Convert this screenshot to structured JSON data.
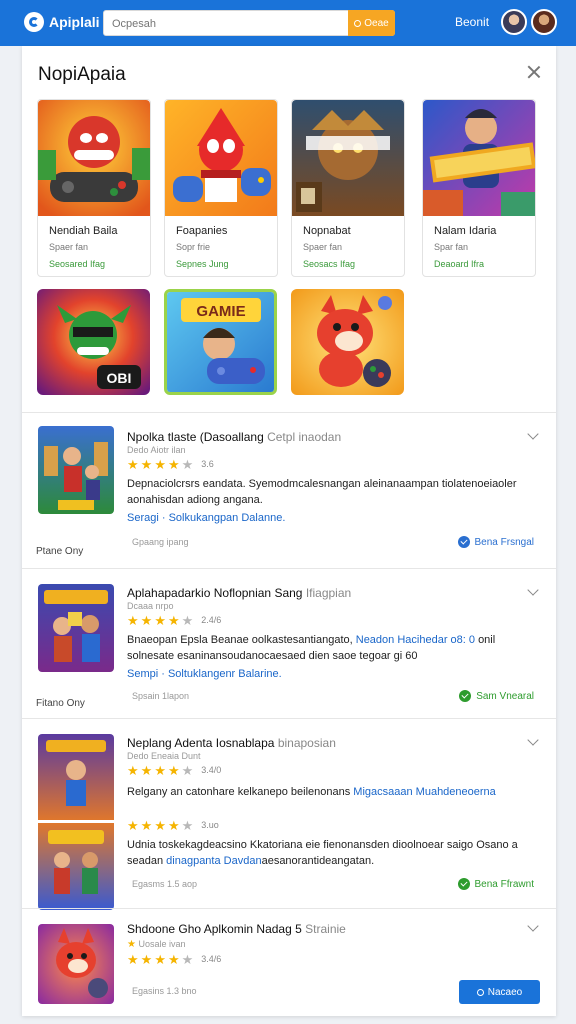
{
  "header": {
    "logo_text": "Apiplali",
    "search_placeholder": "Ocpesah",
    "search_button": "Oeae",
    "user_name": "Beonit"
  },
  "panel": {
    "title": "NopiApaia",
    "cards": [
      {
        "title": "Nendiah Baila",
        "sub": "Spaer fan",
        "status": "Seosared Ifag"
      },
      {
        "title": "Foapanies",
        "sub": "Sopr frie",
        "status": "Sepnes Jung"
      },
      {
        "title": "Nopnabat",
        "sub": "Spaer fan",
        "status": "Seosacs Ifag"
      },
      {
        "title": "Nalam Idaria",
        "sub": "Spar fan",
        "status": "Deaoard Ifra"
      }
    ],
    "tiles": [
      {
        "label": "OBI"
      },
      {
        "label": "GAMIE"
      },
      {
        "label": ""
      }
    ],
    "list": [
      {
        "title": "Npolka tlaste (Dasoallang",
        "title_grey": "Cetpl inaodan",
        "sub": "Dedo Aiotr ilan",
        "rating": "3.6",
        "stars": 4,
        "desc_a": "Depnaciolcrsrs eandata. Syemodmcalesnangan aleinanaampan tiolatenoeiaoler aonahisdan adiong angana.",
        "desc_b": "",
        "link": "Seragi · Solkukangpan Dalanne.",
        "left_note": "Ptane Ony",
        "meta": "Gpaang ipang",
        "status": "Bena Frsngal"
      },
      {
        "title": "Aplahapadarkio Noflopnian Sang",
        "title_grey": "Ifiagpian",
        "sub": "Dcaaa nrpo",
        "rating": "2.4/6",
        "stars": 4,
        "desc_a": "Bnaeopan Epsla Beanae oolkastesantiangato,",
        "desc_b": "Neadon Hacihedar o8: 0",
        "desc_c": "onil solnesate esaninansoudanocaesaed dien saoe tegoar gi 60",
        "link": "Sempi · Soltuklangenr Balarine.",
        "left_note": "Fitano Ony",
        "meta": "Spsain 1lapon",
        "status": "Sam Vnearal"
      },
      {
        "title": "Neplang Adenta Iosnablapa",
        "title_grey": "binaposian",
        "sub": "Dedo Eneaia Dunt",
        "rating": "3.4/0",
        "stars": 4,
        "desc_a": "Relgany an catonhare kelkanepo beilenonans",
        "desc_b": "Migacsaaan Muahdeneoerna",
        "rating2": "3.uo",
        "desc_c": "Udnia toskekagdeacsino Kkatoriana eie fienonansden dioolnoear saigo Osano a seadan",
        "desc_d": "dinagpanta Davdan",
        "desc_e": "aesanorantideangatan.",
        "meta": "Egasms 1.5 aop",
        "status": "Bena Ffrawnt"
      },
      {
        "title": "Shdoone Gho Aplkomin Nadag 5",
        "title_grey": "Strainie",
        "sub": "Uosale ivan",
        "rating": "3.4/6",
        "stars": 4,
        "meta": "Egasins 1.3 bno"
      }
    ],
    "bottom_button": "Nacaeo"
  },
  "colors": {
    "brand": "#1a73d9",
    "search_button": "#f6a623",
    "star": "#f5b400",
    "link": "#1a66c9",
    "success": "#2e9c2e"
  }
}
